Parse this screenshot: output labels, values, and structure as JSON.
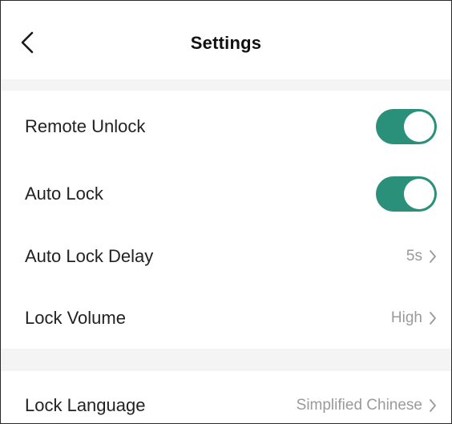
{
  "header": {
    "title": "Settings",
    "back_icon": "chevron-left-icon"
  },
  "colors": {
    "accent": "#2a9079",
    "separator": "#f4f4f4",
    "value_text": "#9a9a9a"
  },
  "settings": {
    "remote_unlock": {
      "label": "Remote Unlock",
      "enabled": true
    },
    "auto_lock": {
      "label": "Auto Lock",
      "enabled": true
    },
    "auto_lock_delay": {
      "label": "Auto Lock Delay",
      "value": "5s"
    },
    "lock_volume": {
      "label": "Lock Volume",
      "value": "High"
    },
    "lock_language": {
      "label": "Lock Language",
      "value": "Simplified Chinese"
    }
  }
}
